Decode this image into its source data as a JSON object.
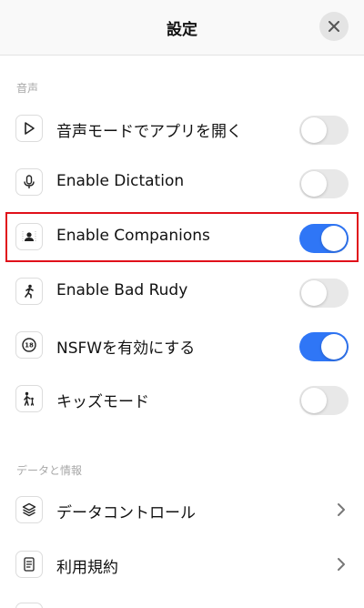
{
  "header": {
    "title": "設定"
  },
  "sections": [
    {
      "title": "音声"
    },
    {
      "title": "データと情報"
    }
  ],
  "rows": [
    {
      "label": "音声モードでアプリを開く",
      "icon": "play-icon",
      "control": "toggle",
      "on": false
    },
    {
      "label": "Enable Dictation",
      "icon": "microphone-icon",
      "control": "toggle",
      "on": false
    },
    {
      "label": "Enable Companions",
      "icon": "companion-avatar-icon",
      "control": "toggle",
      "on": true
    },
    {
      "label": "Enable Bad Rudy",
      "icon": "running-figure-icon",
      "control": "toggle",
      "on": false
    },
    {
      "label": "NSFWを有効にする",
      "icon": "age-18-icon",
      "control": "toggle",
      "on": true
    },
    {
      "label": "キッズモード",
      "icon": "parent-child-icon",
      "control": "toggle",
      "on": false
    },
    {
      "label": "データコントロール",
      "icon": "layers-icon",
      "control": "chevron"
    },
    {
      "label": "利用規約",
      "icon": "document-icon",
      "control": "chevron"
    }
  ],
  "colors": {
    "toggle_on": "#2f76f6",
    "toggle_off": "#e8e8e8",
    "highlight": "#e0101a"
  }
}
